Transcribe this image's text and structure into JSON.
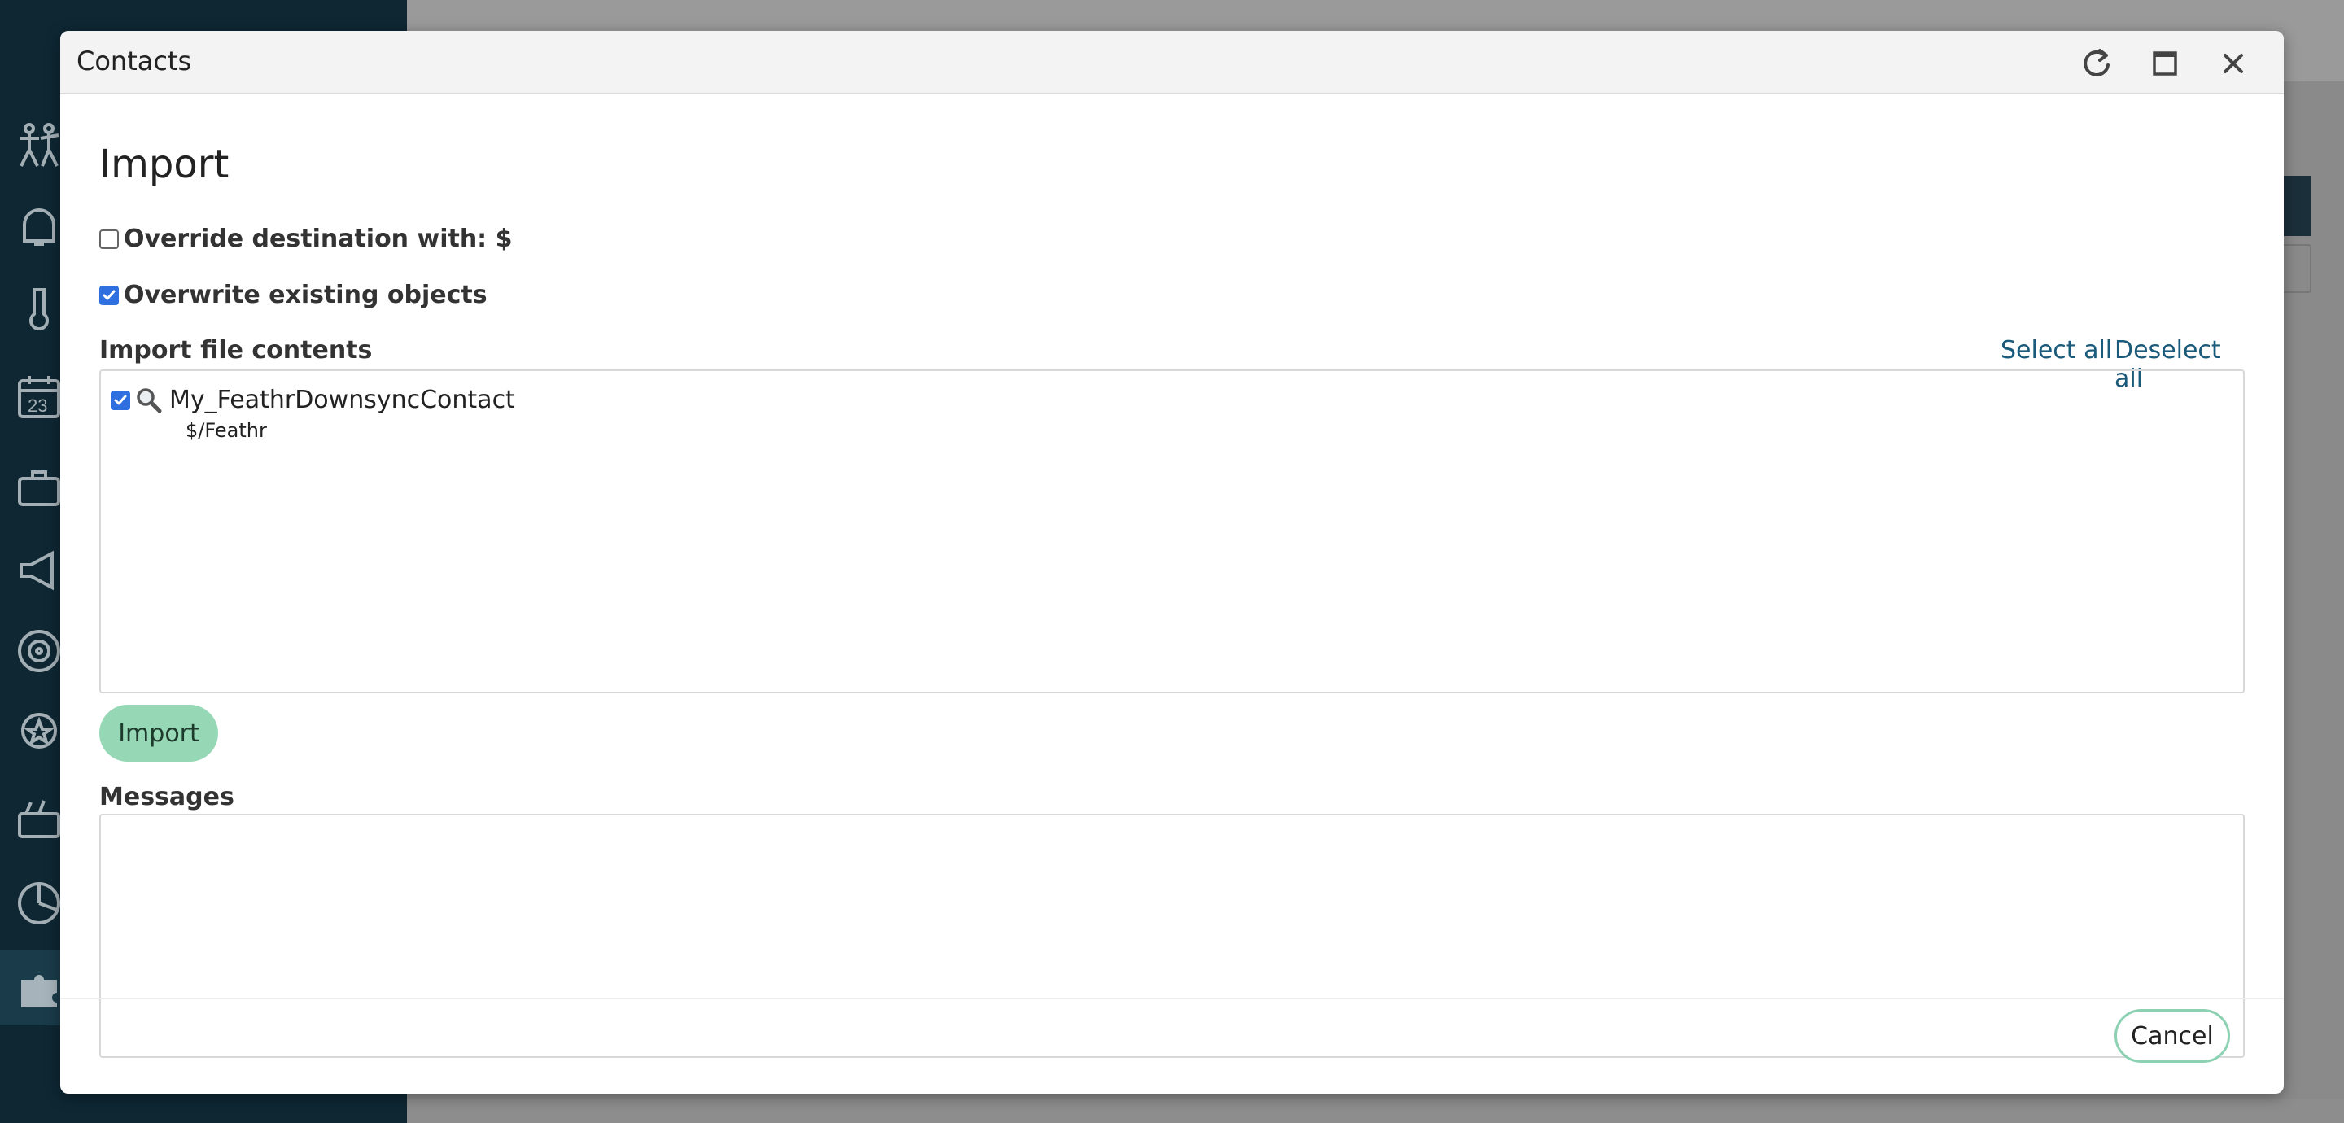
{
  "dialog": {
    "title": "Contacts",
    "refresh_icon": "refresh-icon",
    "maximize_icon": "maximize-icon",
    "close_icon": "close-icon"
  },
  "import": {
    "heading": "Import",
    "override_label": "Override destination with: $",
    "override_checked": false,
    "overwrite_label": "Overwrite existing objects",
    "overwrite_checked": true,
    "file_contents_label": "Import file contents",
    "select_all": "Select all",
    "deselect_all": "Deselect all",
    "items": [
      {
        "name": "My_FeathrDownsyncContact",
        "path": "$/Feathr",
        "checked": true,
        "icon": "magnifier-icon"
      }
    ],
    "import_button": "Import",
    "messages_label": "Messages",
    "cancel_button": "Cancel"
  },
  "colors": {
    "accent_green": "#96d8b6",
    "link_blue": "#1a5a7a",
    "checkbox_blue": "#2f6fdf",
    "sidebar": "#0e2733"
  }
}
